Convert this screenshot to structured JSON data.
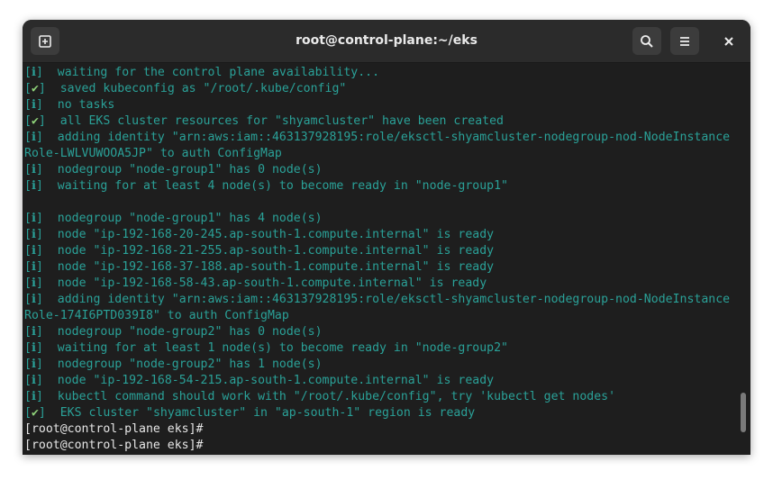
{
  "window": {
    "title": "root@control-plane:~/eks"
  },
  "icons": {
    "new_tab": "new-tab-icon",
    "search": "search-icon",
    "menu": "hamburger-menu-icon",
    "close": "close-icon"
  },
  "colors": {
    "output_text": "#2aa198",
    "check_mark": "#8fd27a",
    "prompt_text": "#e6e6e6",
    "background": "#1e1e1e"
  },
  "terminal": {
    "lines": [
      {
        "tag": "[ℹ]",
        "text": "  waiting for the control plane availability..."
      },
      {
        "tag": "[✔]",
        "text": "  saved kubeconfig as \"/root/.kube/config\""
      },
      {
        "tag": "[ℹ]",
        "text": "  no tasks"
      },
      {
        "tag": "[✔]",
        "text": "  all EKS cluster resources for \"shyamcluster\" have been created"
      },
      {
        "tag": "[ℹ]",
        "text": "  adding identity \"arn:aws:iam::463137928195:role/eksctl-shyamcluster-nodegroup-nod-NodeInstance"
      },
      {
        "tag": "",
        "text": "Role-LWLVUWOOA5JP\" to auth ConfigMap"
      },
      {
        "tag": "[ℹ]",
        "text": "  nodegroup \"node-group1\" has 0 node(s)"
      },
      {
        "tag": "[ℹ]",
        "text": "  waiting for at least 4 node(s) to become ready in \"node-group1\""
      },
      {
        "tag": "",
        "text": ""
      },
      {
        "tag": "[ℹ]",
        "text": "  nodegroup \"node-group1\" has 4 node(s)"
      },
      {
        "tag": "[ℹ]",
        "text": "  node \"ip-192-168-20-245.ap-south-1.compute.internal\" is ready"
      },
      {
        "tag": "[ℹ]",
        "text": "  node \"ip-192-168-21-255.ap-south-1.compute.internal\" is ready"
      },
      {
        "tag": "[ℹ]",
        "text": "  node \"ip-192-168-37-188.ap-south-1.compute.internal\" is ready"
      },
      {
        "tag": "[ℹ]",
        "text": "  node \"ip-192-168-58-43.ap-south-1.compute.internal\" is ready"
      },
      {
        "tag": "[ℹ]",
        "text": "  adding identity \"arn:aws:iam::463137928195:role/eksctl-shyamcluster-nodegroup-nod-NodeInstance"
      },
      {
        "tag": "",
        "text": "Role-174I6PTD039I8\" to auth ConfigMap"
      },
      {
        "tag": "[ℹ]",
        "text": "  nodegroup \"node-group2\" has 0 node(s)"
      },
      {
        "tag": "[ℹ]",
        "text": "  waiting for at least 1 node(s) to become ready in \"node-group2\""
      },
      {
        "tag": "[ℹ]",
        "text": "  nodegroup \"node-group2\" has 1 node(s)"
      },
      {
        "tag": "[ℹ]",
        "text": "  node \"ip-192-168-54-215.ap-south-1.compute.internal\" is ready"
      },
      {
        "tag": "[ℹ]",
        "text": "  kubectl command should work with \"/root/.kube/config\", try 'kubectl get nodes'"
      },
      {
        "tag": "[✔]",
        "text": "  EKS cluster \"shyamcluster\" in \"ap-south-1\" region is ready"
      }
    ],
    "prompts": [
      "[root@control-plane eks]#",
      "[root@control-plane eks]#"
    ]
  }
}
